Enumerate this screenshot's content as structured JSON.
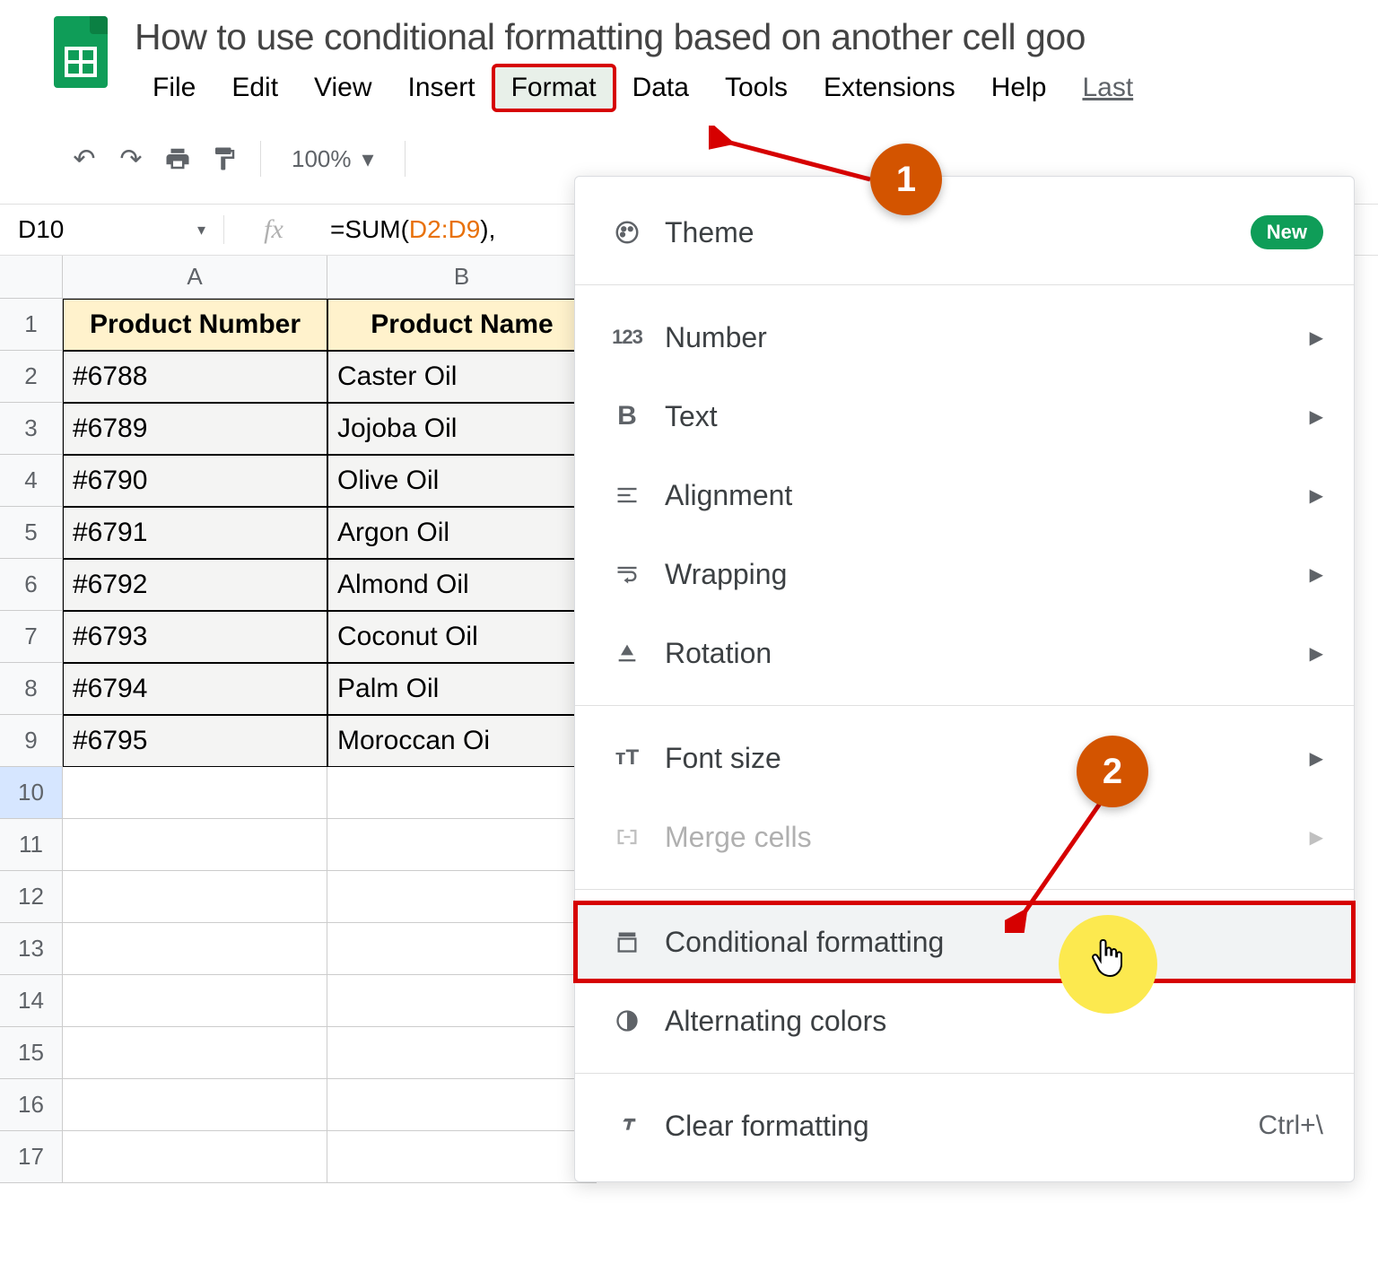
{
  "doc_title": "How to use conditional formatting based on another cell goo",
  "menubar": {
    "file": "File",
    "edit": "Edit",
    "view": "View",
    "insert": "Insert",
    "format": "Format",
    "data": "Data",
    "tools": "Tools",
    "extensions": "Extensions",
    "help": "Help",
    "last": "Last"
  },
  "toolbar": {
    "zoom": "100%"
  },
  "formula_bar": {
    "name_box": "D10",
    "fx": "fx",
    "prefix": "=SUM(",
    "ref": "D2:D9",
    "suffix": "),"
  },
  "columns": {
    "A": "A",
    "B": "B"
  },
  "headers": {
    "col_a": "Product Number",
    "col_b": "Product Name"
  },
  "rows": [
    {
      "num": "1"
    },
    {
      "num": "2",
      "a": "#6788",
      "b": "Caster Oil"
    },
    {
      "num": "3",
      "a": "#6789",
      "b": "Jojoba Oil"
    },
    {
      "num": "4",
      "a": "#6790",
      "b": "Olive Oil"
    },
    {
      "num": "5",
      "a": "#6791",
      "b": "Argon Oil"
    },
    {
      "num": "6",
      "a": "#6792",
      "b": "Almond Oil"
    },
    {
      "num": "7",
      "a": "#6793",
      "b": "Coconut Oil"
    },
    {
      "num": "8",
      "a": "#6794",
      "b": "Palm Oil"
    },
    {
      "num": "9",
      "a": "#6795",
      "b": "Moroccan Oi"
    },
    {
      "num": "10"
    },
    {
      "num": "11"
    },
    {
      "num": "12"
    },
    {
      "num": "13"
    },
    {
      "num": "14"
    },
    {
      "num": "15"
    },
    {
      "num": "16"
    },
    {
      "num": "17"
    }
  ],
  "format_menu": {
    "theme": {
      "label": "Theme",
      "icon": "palette-icon",
      "badge": "New"
    },
    "number": {
      "label": "Number",
      "icon": "number-icon",
      "submenu": true,
      "icon_text": "123"
    },
    "text": {
      "label": "Text",
      "icon": "bold-icon",
      "submenu": true,
      "icon_text": "B"
    },
    "alignment": {
      "label": "Alignment",
      "icon": "align-icon",
      "submenu": true
    },
    "wrapping": {
      "label": "Wrapping",
      "icon": "wrap-icon",
      "submenu": true
    },
    "rotation": {
      "label": "Rotation",
      "icon": "rotation-icon",
      "submenu": true
    },
    "font_size": {
      "label": "Font size",
      "icon": "fontsize-icon",
      "submenu": true,
      "icon_text": "тT"
    },
    "merge": {
      "label": "Merge cells",
      "icon": "merge-icon",
      "submenu": true,
      "disabled": true
    },
    "conditional": {
      "label": "Conditional formatting",
      "icon": "cond-format-icon"
    },
    "alternating": {
      "label": "Alternating colors",
      "icon": "alt-colors-icon"
    },
    "clear": {
      "label": "Clear formatting",
      "icon": "clear-format-icon",
      "shortcut": "Ctrl+\\"
    }
  },
  "annotations": {
    "callout1": "1",
    "callout2": "2"
  }
}
